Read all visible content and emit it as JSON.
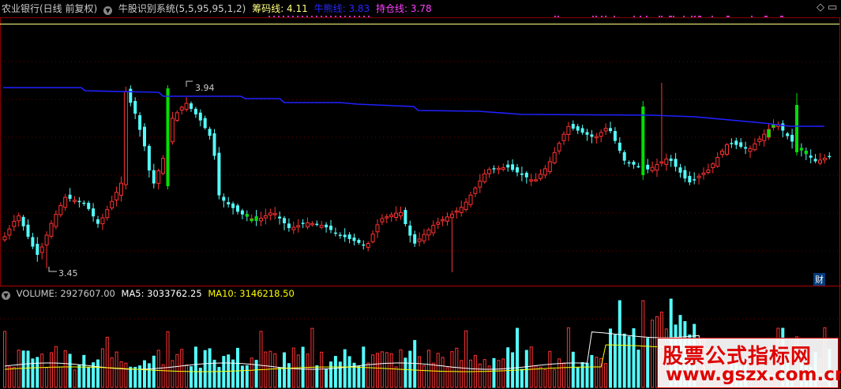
{
  "header": {
    "stock": "农业银行(日线 前复权)",
    "indicator": "牛股识别系统(5,5,95,95,1,2)",
    "chouma_label": "筹码线: 4.11",
    "niuxian_label": "牛熊线: 3.83",
    "chicang_label": "持仓线: 3.78",
    "colors": {
      "stock": "#cccccc",
      "chouma": "#ffff80",
      "niuxian": "#2020ff",
      "chicang": "#ff40ff"
    }
  },
  "price_annotations": {
    "high": "3.94",
    "low": "3.45"
  },
  "volume_header": {
    "volume_label": "VOLUME: 2927607.00",
    "ma5_label": "MA5: 3033762.25",
    "ma10_label": "MA10: 3146218.50"
  },
  "cai_button": "财",
  "watermark": {
    "title": "股票公式指标网",
    "url": "www.gszx.com.cn"
  },
  "chart_data": {
    "type": "candlestick",
    "y_high_value": 3.94,
    "y_low_value": 3.45,
    "colors": {
      "up": "#ff3232",
      "down": "#54fcfc",
      "bull_signal": "#00e000",
      "niuxian": "#2020ff",
      "chouma_dots": "#ff40ff",
      "volume_ma5": "#ffffff",
      "volume_ma10": "#ffff00"
    }
  }
}
